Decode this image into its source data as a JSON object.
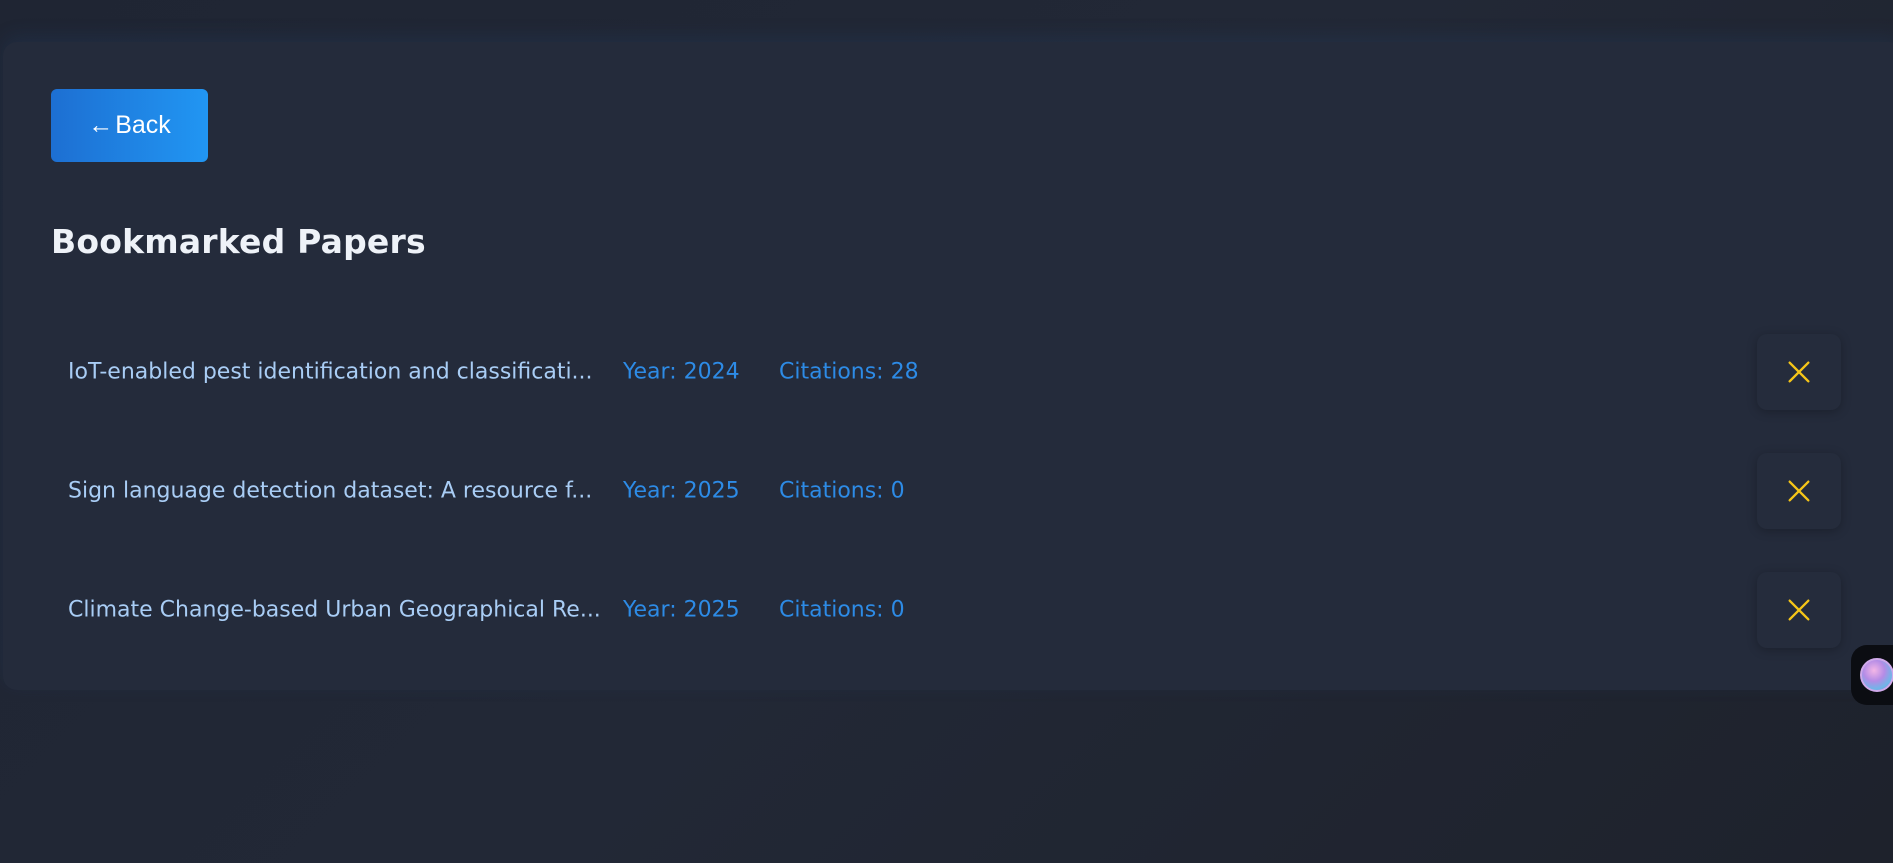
{
  "back_button": {
    "arrow": "←",
    "label": "Back"
  },
  "page_title": "Bookmarked Papers",
  "papers": [
    {
      "title": "IoT-enabled pest identification and classificati...",
      "year": "Year: 2024",
      "citations": "Citations: 28"
    },
    {
      "title": "Sign language detection dataset: A resource f...",
      "year": "Year: 2025",
      "citations": "Citations: 0"
    },
    {
      "title": "Climate Change-based Urban Geographical Re...",
      "year": "Year: 2025",
      "citations": "Citations: 0"
    }
  ],
  "icons": {
    "remove": "close-icon",
    "assistant": "assistant-avatar-icon"
  },
  "colors": {
    "accent": "#2196f3",
    "remove_icon": "#f5c518",
    "title_text": "#a9cdf5",
    "meta_text": "#2d8be6"
  }
}
